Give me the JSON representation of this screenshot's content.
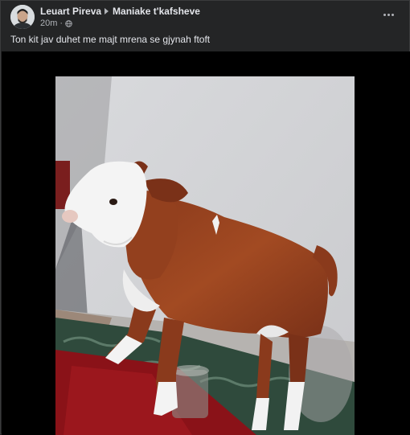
{
  "post": {
    "author": "Leuart Pireva",
    "group": "Maniake t'kafsheve",
    "time": "20m",
    "separator": "·",
    "audience_icon": "globe-icon",
    "more_icon": "more-options-icon",
    "caption": "Ton kit jav duhet me majt mrena se gjynah ftoft"
  },
  "colors": {
    "background": "#242526",
    "media_background": "#000000",
    "primary_text": "#e4e6eb",
    "secondary_text": "#b0b3b8"
  }
}
